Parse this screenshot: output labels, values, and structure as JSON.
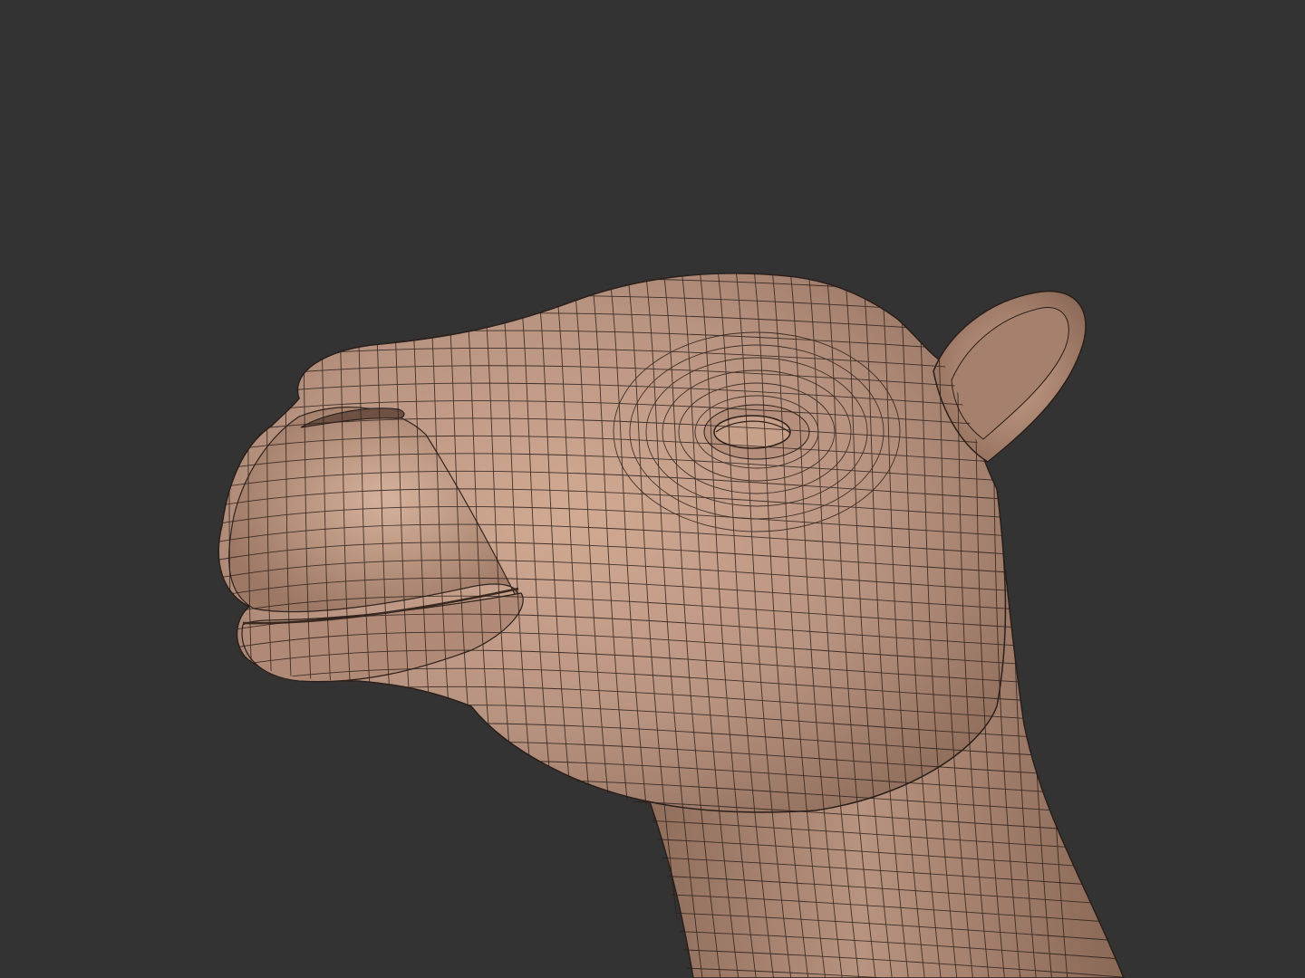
{
  "scene": {
    "subject": "camel-head-wireframe-render",
    "colors": {
      "background": "#333333",
      "skin_light": "#c9a18a",
      "skin_mid": "#b48f7a",
      "skin_dark": "#8e6a58",
      "wire": "#2a1f1a"
    }
  }
}
